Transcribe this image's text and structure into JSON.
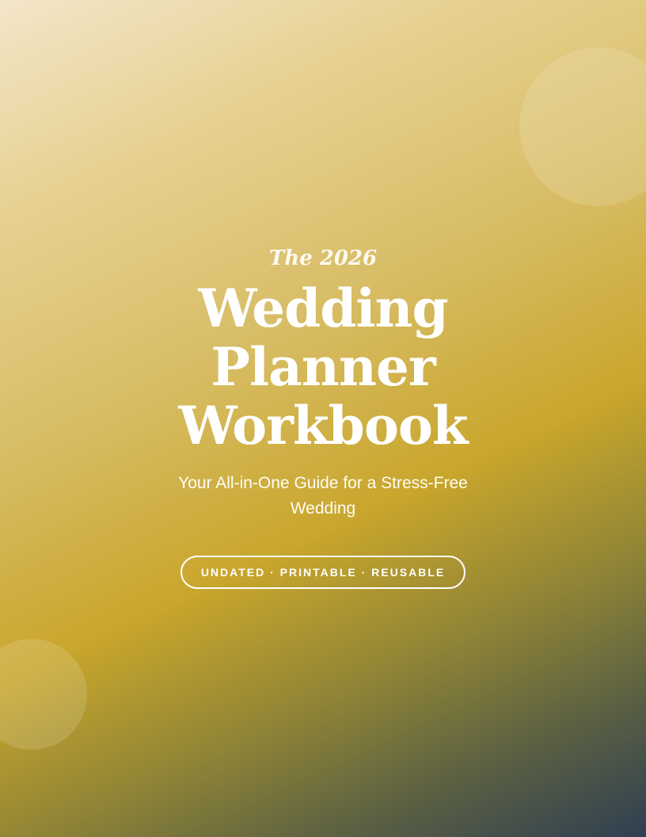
{
  "cover": {
    "pre_title": "The 2026",
    "title_lines": [
      "Wedding",
      "Planner",
      "Workbook"
    ],
    "subtitle": "Your All-in-One Guide for a Stress-Free Wedding",
    "badge": "UNDATED · PRINTABLE · REUSABLE"
  },
  "colors": {
    "gradient_start": "#f3e6c9",
    "gold": "#c9a62c",
    "gradient_end": "#2f3f52",
    "text": "#ffffff"
  }
}
